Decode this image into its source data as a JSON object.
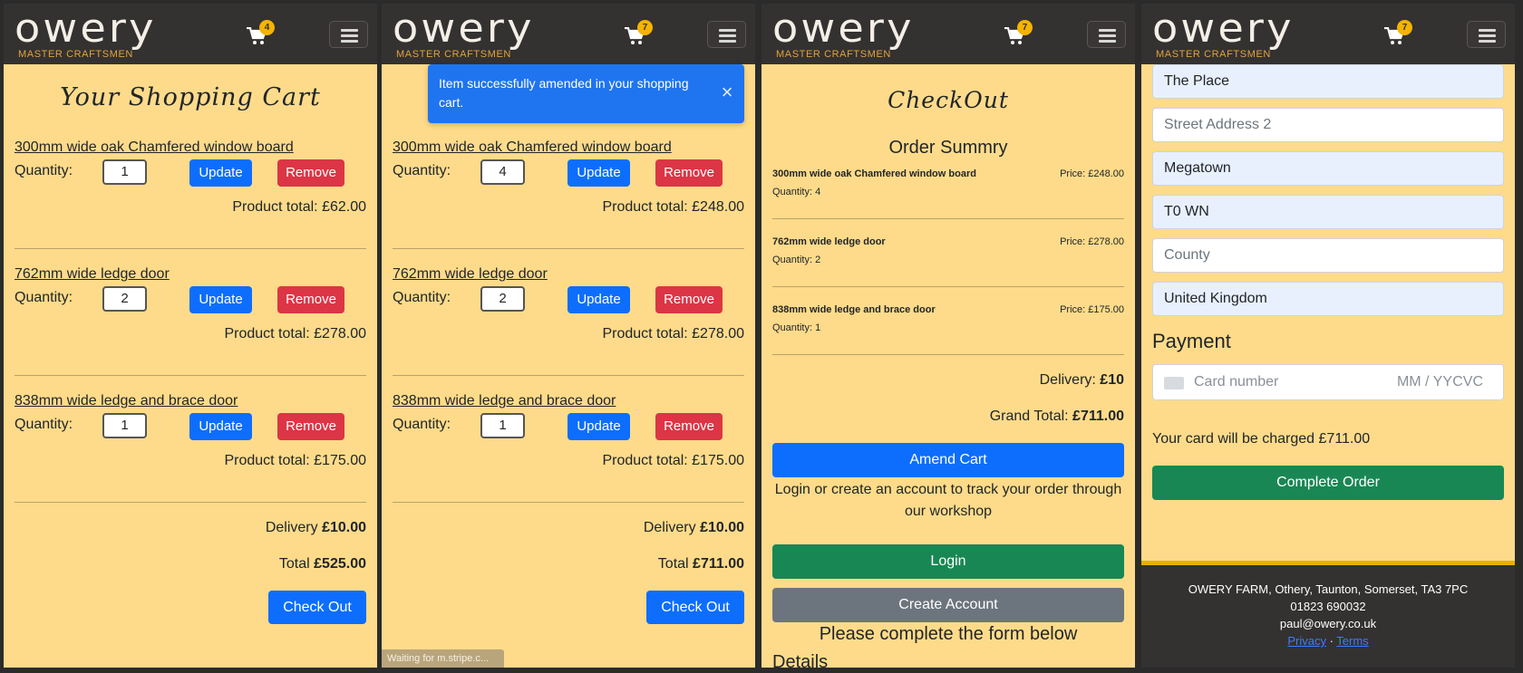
{
  "brand": {
    "logo_word": "owery",
    "logo_sub": "MASTER CRAFTSMEN"
  },
  "panels": [
    {
      "cart_count": "4"
    },
    {
      "cart_count": "7"
    },
    {
      "cart_count": "7"
    },
    {
      "cart_count": "7"
    }
  ],
  "cart1": {
    "title": "Your Shopping Cart",
    "items": [
      {
        "name": "300mm wide oak Chamfered window board",
        "qty_label": "Quantity:",
        "qty": "1",
        "update": "Update",
        "remove": "Remove",
        "total": "Product total: £62.00"
      },
      {
        "name": "762mm wide ledge door",
        "qty_label": "Quantity:",
        "qty": "2",
        "update": "Update",
        "remove": "Remove",
        "total": "Product total: £278.00"
      },
      {
        "name": "838mm wide ledge and brace door",
        "qty_label": "Quantity:",
        "qty": "1",
        "update": "Update",
        "remove": "Remove",
        "total": "Product total: £175.00"
      }
    ],
    "delivery_label": "Delivery ",
    "delivery_value": "£10.00",
    "total_label": "Total ",
    "total_value": "£525.00",
    "checkout": "Check Out"
  },
  "cart2": {
    "toast": "Item successfully amended in your shopping cart.",
    "toast_close": "×",
    "items": [
      {
        "name": "300mm wide oak Chamfered window board",
        "qty_label": "Quantity:",
        "qty": "4",
        "update": "Update",
        "remove": "Remove",
        "total": "Product total: £248.00"
      },
      {
        "name": "762mm wide ledge door",
        "qty_label": "Quantity:",
        "qty": "2",
        "update": "Update",
        "remove": "Remove",
        "total": "Product total: £278.00"
      },
      {
        "name": "838mm wide ledge and brace door",
        "qty_label": "Quantity:",
        "qty": "1",
        "update": "Update",
        "remove": "Remove",
        "total": "Product total: £175.00"
      }
    ],
    "delivery_label": "Delivery ",
    "delivery_value": "£10.00",
    "total_label": "Total ",
    "total_value": "£711.00",
    "checkout": "Check Out",
    "status": "Waiting for m.stripe.c..."
  },
  "checkout": {
    "title": "CheckOut",
    "summary_title": "Order Summry",
    "items": [
      {
        "name": "300mm wide oak Chamfered window board",
        "price": "Price: £248.00",
        "qty": "Quantity: 4"
      },
      {
        "name": "762mm wide ledge door",
        "price": "Price: £278.00",
        "qty": "Quantity: 2"
      },
      {
        "name": "838mm wide ledge and brace door",
        "price": "Price: £175.00",
        "qty": "Quantity: 1"
      }
    ],
    "delivery_label": "Delivery: ",
    "delivery_value": "£10",
    "grand_label": "Grand Total: ",
    "grand_value": "£711.00",
    "amend": "Amend Cart",
    "login_prompt": "Login or create an account to track your order through our workshop",
    "login": "Login",
    "create": "Create Account",
    "complete_form": "Please complete the form below",
    "details": "Details"
  },
  "payment": {
    "fields": [
      {
        "value": "The Place",
        "state": "filled"
      },
      {
        "value": "Street Address 2",
        "state": "placeholder"
      },
      {
        "value": "Megatown",
        "state": "filled"
      },
      {
        "value": "T0 WN",
        "state": "filled"
      },
      {
        "value": "County",
        "state": "placeholder"
      },
      {
        "value": "United Kingdom",
        "state": "filled"
      }
    ],
    "heading": "Payment",
    "card_placeholder": "Card number",
    "card_expiry": "MM / YY",
    "card_cvc": "CVC",
    "charge_note": "Your card will be charged £711.00",
    "complete": "Complete Order",
    "footer": {
      "address": "OWERY FARM, Othery, Taunton, Somerset, TA3 7PC",
      "phone": "01823 690032",
      "email": "paul@owery.co.uk",
      "privacy": "Privacy",
      "sep": " · ",
      "terms": "Terms"
    }
  }
}
